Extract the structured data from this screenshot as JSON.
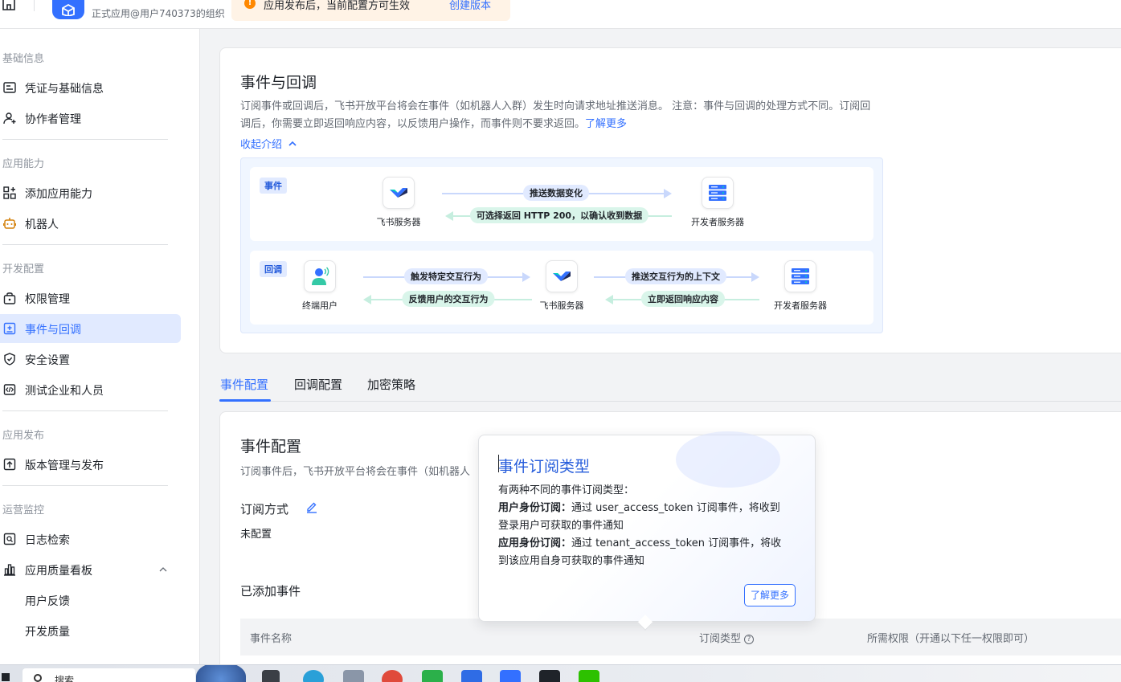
{
  "topbar": {
    "org_text": "正式应用@用户740373的组织",
    "banner_text": "应用发布后，当前配置方可生效",
    "banner_link": "创建版本"
  },
  "sidebar": {
    "groups": [
      {
        "title": "基础信息",
        "items": [
          "凭证与基础信息",
          "协作者管理"
        ]
      },
      {
        "title": "应用能力",
        "items": [
          "添加应用能力",
          "机器人"
        ]
      },
      {
        "title": "开发配置",
        "items": [
          "权限管理",
          "事件与回调",
          "安全设置",
          "测试企业和人员"
        ]
      },
      {
        "title": "应用发布",
        "items": [
          "版本管理与发布"
        ]
      },
      {
        "title": "运营监控",
        "items": [
          "日志检索",
          "应用质量看板",
          "用户反馈",
          "开发质量"
        ]
      }
    ],
    "active_item": "事件与回调"
  },
  "intro": {
    "title": "事件与回调",
    "desc_line1": "订阅事件或回调后，飞书开放平台将会在事件（如机器人入群）发生时向请求地址推送消息。 注意：事件与回调的处理方式不",
    "desc_line2": "同。订阅回调后，你需要立即返回响应内容，以反馈用户操作，而事件则不要求返回。",
    "learn_more": "了解更多",
    "collapse": "收起介绍",
    "diagram": {
      "event_row": {
        "tag": "事件",
        "left_node": "飞书服务器",
        "right_node": "开发者服务器",
        "arrow_right": "推送数据变化",
        "arrow_left": "可选择返回 HTTP 200，以确认收到数据"
      },
      "callback_row": {
        "tag": "回调",
        "node1": "终端用户",
        "node2": "飞书服务器",
        "node3": "开发者服务器",
        "arrow1_right": "触发特定交互行为",
        "arrow1_left": "反馈用户的交互行为",
        "arrow2_right": "推送交互行为的上下文",
        "arrow2_left": "立即返回响应内容"
      }
    }
  },
  "tabs": [
    "事件配置",
    "回调配置",
    "加密策略"
  ],
  "config": {
    "title": "事件配置",
    "desc": "订阅事件后，飞书开放平台将会在事件（如机器人",
    "subscribe_label": "订阅方式",
    "subscribe_value": "未配置",
    "added_events": "已添加事件",
    "table_headers": {
      "name": "事件名称",
      "type": "订阅类型",
      "perm": "所需权限（开通以下任一权限即可）"
    }
  },
  "popover": {
    "title": "事件订阅类型",
    "intro": "有两种不同的事件订阅类型：",
    "user_label": "用户身份订阅：",
    "user_text1": "通过 user_access_token 订阅事件，将收到",
    "user_text2": "登录用户可获取的事件通知",
    "app_label": "应用身份订阅：",
    "app_text1": "通过 tenant_access_token 订阅事件，将收",
    "app_text2": "到该应用自身可获取的事件通知",
    "button": "了解更多"
  },
  "taskbar": {
    "search_text": "搜索"
  },
  "colors": {
    "accent": "#3370ff",
    "active_bg": "#e1eaff",
    "warning": "#ff8800"
  }
}
